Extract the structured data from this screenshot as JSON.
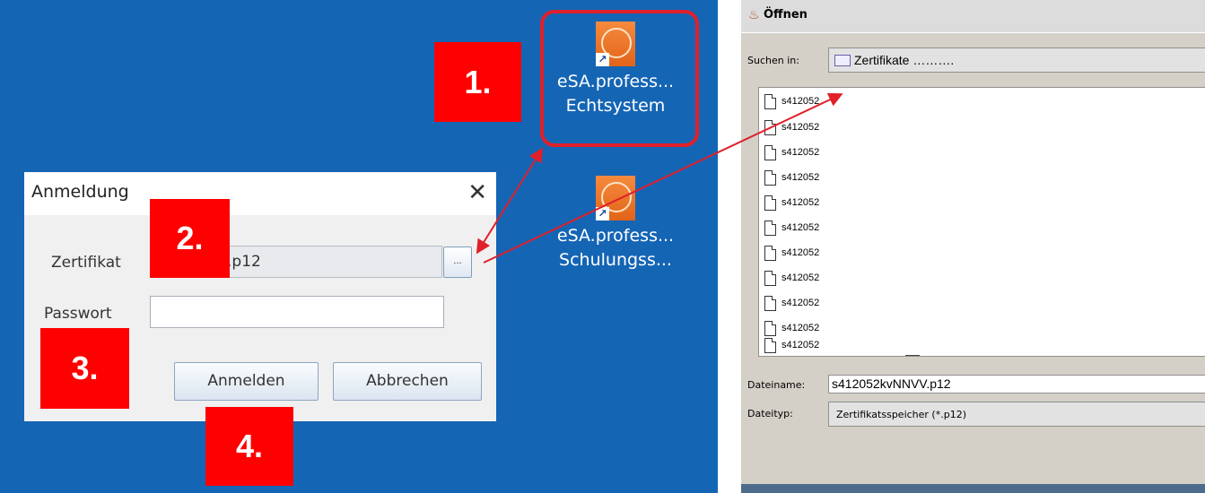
{
  "desktop": {
    "icons": [
      {
        "line1": "eSA.profess...",
        "line2": "Echtsystem",
        "icon": "esa-app-icon"
      },
      {
        "line1": "eSA.profess...",
        "line2": "Schulungss...",
        "icon": "esa-app-icon"
      }
    ]
  },
  "steps": [
    "1.",
    "2.",
    "3.",
    "4."
  ],
  "login_dialog": {
    "title": "Anmeldung",
    "close_glyph": "✕",
    "certificate_label": "Zertifikat",
    "certificate_value": ".p12",
    "browse_label": "...",
    "password_label": "Passwort",
    "password_value": "",
    "login_button": "Anmelden",
    "cancel_button": "Abbrechen"
  },
  "open_dialog": {
    "title": "Öffnen",
    "look_in_label": "Suchen in:",
    "look_in_value": "Zertifikate ……….",
    "files": [
      "s412052",
      "s412052",
      "s412052",
      "s412052",
      "s412052",
      "s412052",
      "s412052",
      "s412052",
      "s412052",
      "s412052",
      "s412052"
    ],
    "filename_label": "Dateiname:",
    "filename_value": "s412052kvNNVV.p12",
    "filetype_label": "Dateityp:",
    "filetype_value": "Zertifikatsspeicher (*.p12)"
  },
  "colors": {
    "desktop": "#1565b5",
    "step_marker": "#ff0000",
    "annotation": "#e0202a"
  }
}
